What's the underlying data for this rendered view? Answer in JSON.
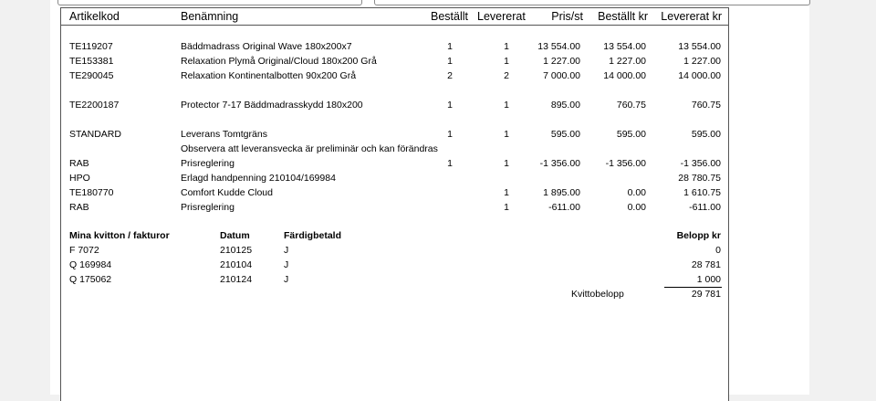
{
  "columns": {
    "code": "Artikelkod",
    "name": "Benämning",
    "ordered": "Beställt",
    "delivered": "Levererat",
    "price": "Pris/st",
    "ordered_kr": "Beställt kr",
    "delivered_kr": "Levererat kr"
  },
  "items": [
    {
      "code": "TE119207",
      "name": "Bäddmadrass Original Wave 180x200x7",
      "ordered": "1",
      "delivered": "1",
      "price": "13 554.00",
      "ordered_kr": "13 554.00",
      "delivered_kr": "13 554.00"
    },
    {
      "code": "TE153381",
      "name": "Relaxation Plymå Original/Cloud 180x200 Grå",
      "ordered": "1",
      "delivered": "1",
      "price": "1 227.00",
      "ordered_kr": "1 227.00",
      "delivered_kr": "1 227.00"
    },
    {
      "code": "TE290045",
      "name": "Relaxation Kontinentalbotten 90x200 Grå",
      "ordered": "2",
      "delivered": "2",
      "price": "7 000.00",
      "ordered_kr": "14 000.00",
      "delivered_kr": "14 000.00"
    },
    {
      "code": "TE2200187",
      "name": "Protector 7-17 Bäddmadrasskydd 180x200",
      "ordered": "1",
      "delivered": "1",
      "price": "895.00",
      "ordered_kr": "760.75",
      "delivered_kr": "760.75"
    },
    {
      "code": "STANDARD",
      "name": "Leverans Tomtgräns",
      "ordered": "1",
      "delivered": "1",
      "price": "595.00",
      "ordered_kr": "595.00",
      "delivered_kr": "595.00"
    },
    {
      "code": "",
      "name": "Observera att leveransvecka är preliminär och kan förändras",
      "ordered": "",
      "delivered": "",
      "price": "",
      "ordered_kr": "",
      "delivered_kr": ""
    },
    {
      "code": "RAB",
      "name": "Prisreglering",
      "ordered": "1",
      "delivered": "1",
      "price": "-1 356.00",
      "ordered_kr": "-1 356.00",
      "delivered_kr": "-1 356.00"
    },
    {
      "code": "HPO",
      "name": "Erlagd handpenning 210104/169984",
      "ordered": "",
      "delivered": "",
      "price": "",
      "ordered_kr": "",
      "delivered_kr": "28 780.75"
    },
    {
      "code": "TE180770",
      "name": "Comfort Kudde Cloud",
      "ordered": "",
      "delivered": "1",
      "price": "1 895.00",
      "ordered_kr": "0.00",
      "delivered_kr": "1 610.75"
    },
    {
      "code": "RAB",
      "name": "Prisreglering",
      "ordered": "",
      "delivered": "1",
      "price": "-611.00",
      "ordered_kr": "0.00",
      "delivered_kr": "-611.00"
    }
  ],
  "receipts": {
    "headers": {
      "doc": "Mina kvitton / fakturor",
      "date": "Datum",
      "paid": "Färdigbetald",
      "amount": "Belopp kr"
    },
    "rows": [
      {
        "doc": "F  7072",
        "date": "210125",
        "paid": "J",
        "amount": "0"
      },
      {
        "doc": "Q 169984",
        "date": "210104",
        "paid": "J",
        "amount": "28 781"
      },
      {
        "doc": "Q 175062",
        "date": "210124",
        "paid": "J",
        "amount": "1 000"
      }
    ],
    "total_label": "Kvittobelopp",
    "total_value": "29 781"
  }
}
